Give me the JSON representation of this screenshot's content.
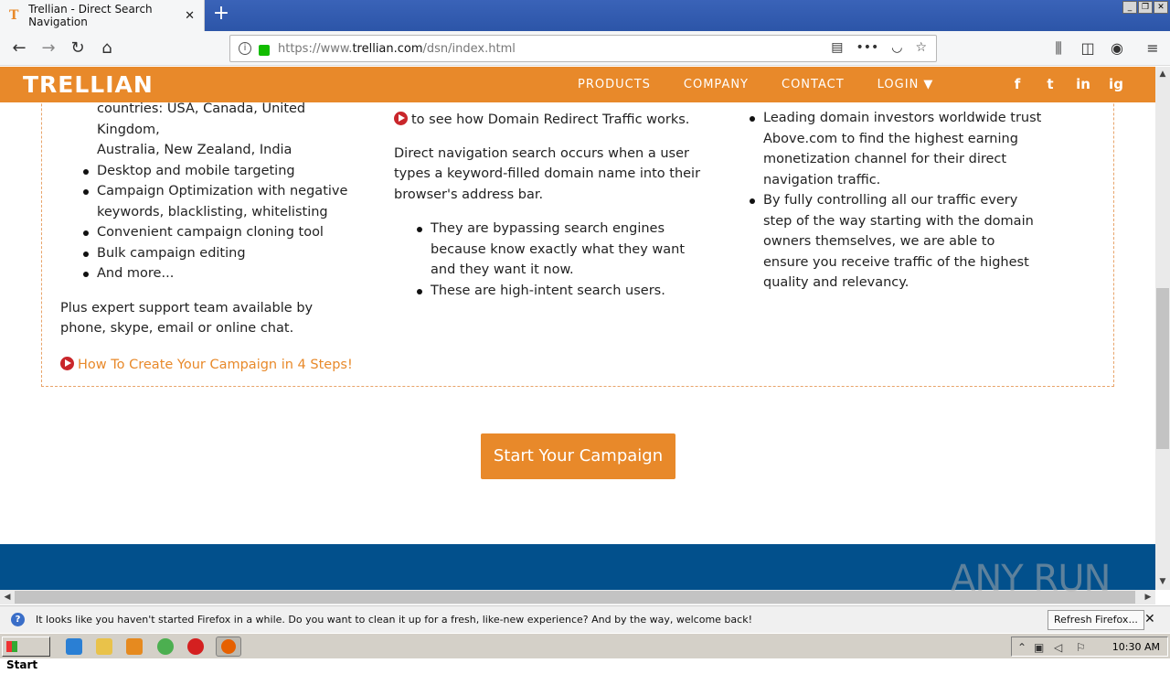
{
  "browser": {
    "tab_title": "Trellian - Direct Search Navigation",
    "tab_favicon": "T",
    "url_prefix": "https://www.",
    "url_domain": "trellian.com",
    "url_path": "/dsn/index.html"
  },
  "site": {
    "logo": "TRELLIAN",
    "menu": [
      "PRODUCTS",
      "COMPANY",
      "CONTACT",
      "LOGIN ▼"
    ],
    "social": [
      "f",
      "t",
      "in",
      "ig"
    ]
  },
  "col1": {
    "partial_line1": "countries: USA, Canada, United Kingdom,",
    "partial_line2": "Australia, New Zealand, India",
    "bullets": [
      "Desktop and mobile targeting",
      "Campaign Optimization with negative keywords, blacklisting, whitelisting",
      "Convenient campaign cloning tool",
      "Bulk campaign editing",
      "And more..."
    ],
    "support": "Plus expert support team available by phone, skype, email or online chat.",
    "link": "How To Create Your Campaign in 4 Steps!"
  },
  "col2": {
    "watch_line": "to see how Domain Redirect Traffic works.",
    "paragraph": "Direct navigation search occurs when a user types a keyword-filled domain name into their browser's address bar.",
    "bullets": [
      "They are bypassing search engines because know exactly what they want and they want it now.",
      "These are high-intent search users."
    ]
  },
  "col3": {
    "bullets": [
      "Leading domain investors worldwide trust Above.com to find the highest earning monetization channel for their direct navigation traffic.",
      "By fully controlling all our traffic every step of the way starting with the domain owners themselves, we are able to ensure you receive traffic of the highest quality and relevancy."
    ]
  },
  "cta": "Start Your Campaign",
  "notification": {
    "text": "It looks like you haven't started Firefox in a while. Do you want to clean it up for a fresh, like-new experience? And by the way, welcome back!",
    "button": "Refresh Firefox..."
  },
  "taskbar": {
    "start": "Start",
    "clock": "10:30 AM"
  },
  "watermark": "ANY RUN",
  "colors": {
    "brand_orange": "#e8892a",
    "footer_blue": "#02508c"
  }
}
